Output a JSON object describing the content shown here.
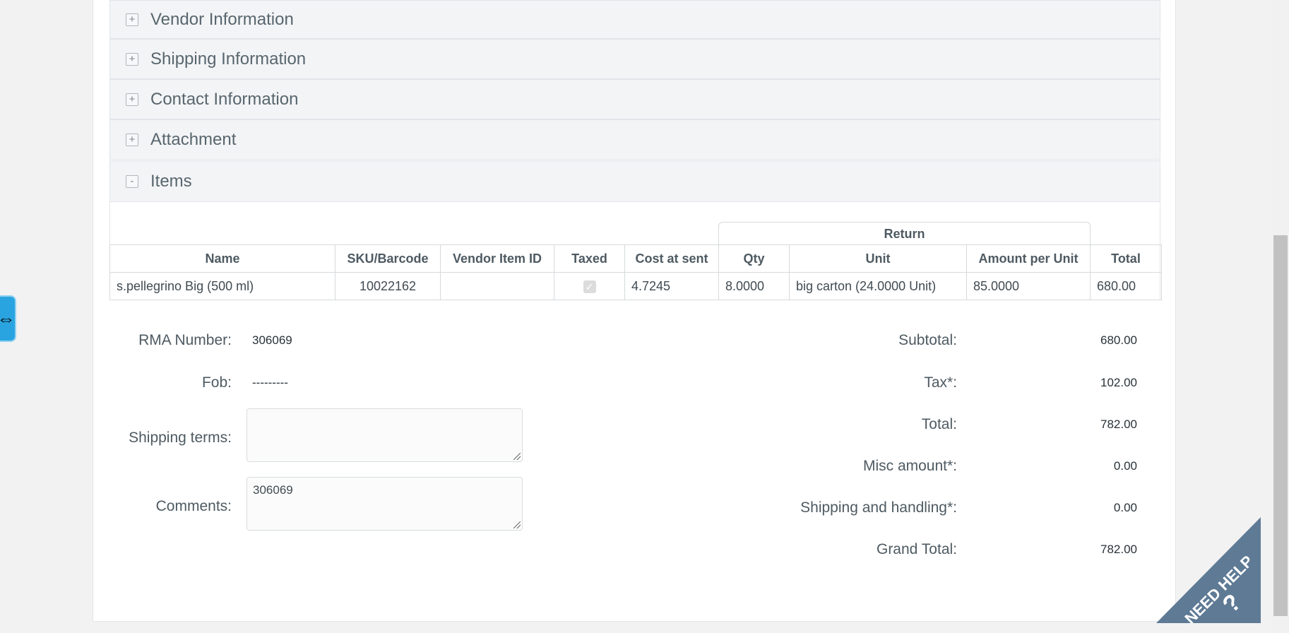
{
  "panels": [
    {
      "title": "Vendor Information",
      "toggle": "+"
    },
    {
      "title": "Shipping Information",
      "toggle": "+"
    },
    {
      "title": "Contact Information",
      "toggle": "+"
    },
    {
      "title": "Attachment",
      "toggle": "+"
    },
    {
      "title": "Items",
      "toggle": "-"
    }
  ],
  "items_table": {
    "group_header": "Return",
    "columns": [
      "Name",
      "SKU/Barcode",
      "Vendor Item ID",
      "Taxed",
      "Cost at sent",
      "Qty",
      "Unit",
      "Amount per Unit",
      "Total"
    ],
    "rows": [
      {
        "name": "s.pellegrino Big (500 ml)",
        "sku": "10022162",
        "vendor_item_id": "",
        "taxed": true,
        "cost_at_sent": "4.7245",
        "qty": "8.0000",
        "unit": "big carton (24.0000 Unit)",
        "amount_per_unit": "85.0000",
        "total": "680.00"
      }
    ]
  },
  "form": {
    "rma_label": "RMA Number:",
    "rma_value": "306069",
    "fob_label": "Fob:",
    "fob_value": "---------",
    "shipping_terms_label": "Shipping terms:",
    "shipping_terms_value": "",
    "comments_label": "Comments:",
    "comments_value": "306069"
  },
  "totals": {
    "subtotal_label": "Subtotal:",
    "subtotal": "680.00",
    "tax_label": "Tax*:",
    "tax": "102.00",
    "total_label": "Total:",
    "total": "782.00",
    "misc_label": "Misc amount*:",
    "misc": "0.00",
    "shipping_label": "Shipping and handling*:",
    "shipping": "0.00",
    "grand_total_label": "Grand Total:",
    "grand_total": "782.00"
  },
  "help_badge": {
    "text": "NEED HELP",
    "symbol": "?"
  },
  "side_tab": {
    "symbol": "⇔"
  },
  "colors": {
    "help_bg": "#5e7a95",
    "side_tab": "#2aa4e0",
    "panel_bg": "#f3f4f6"
  }
}
